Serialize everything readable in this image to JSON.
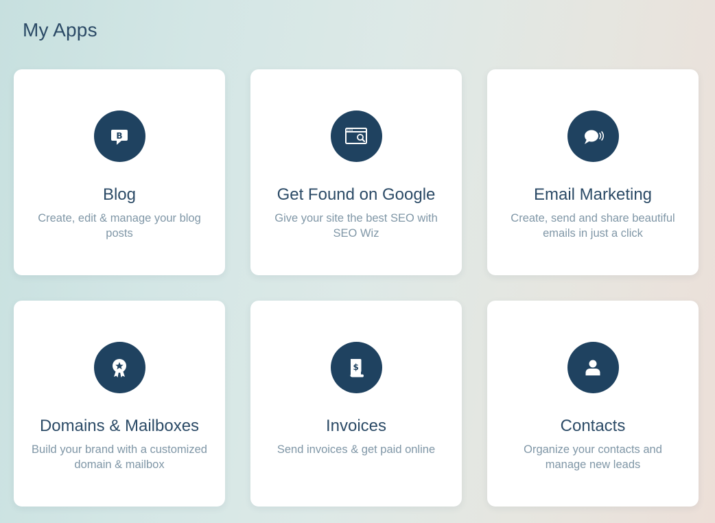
{
  "page": {
    "title": "My Apps"
  },
  "colors": {
    "icon_bg": "#1f4260",
    "title_text": "#2b4a66",
    "desc_text": "#7f96a6",
    "card_bg": "#ffffff"
  },
  "apps": [
    {
      "title": "Blog",
      "description": "Create, edit & manage your blog posts",
      "icon": "blog-icon"
    },
    {
      "title": "Get Found on Google",
      "description": "Give your site the best SEO with SEO Wiz",
      "icon": "seo-search-icon"
    },
    {
      "title": "Email Marketing",
      "description": "Create, send and share beautiful emails in just a click",
      "icon": "chat-broadcast-icon"
    },
    {
      "title": "Domains & Mailboxes",
      "description": "Build your brand with a customized domain & mailbox",
      "icon": "award-badge-icon"
    },
    {
      "title": "Invoices",
      "description": "Send invoices & get paid online",
      "icon": "invoice-icon"
    },
    {
      "title": "Contacts",
      "description": "Organize your contacts and manage new leads",
      "icon": "person-icon"
    }
  ]
}
